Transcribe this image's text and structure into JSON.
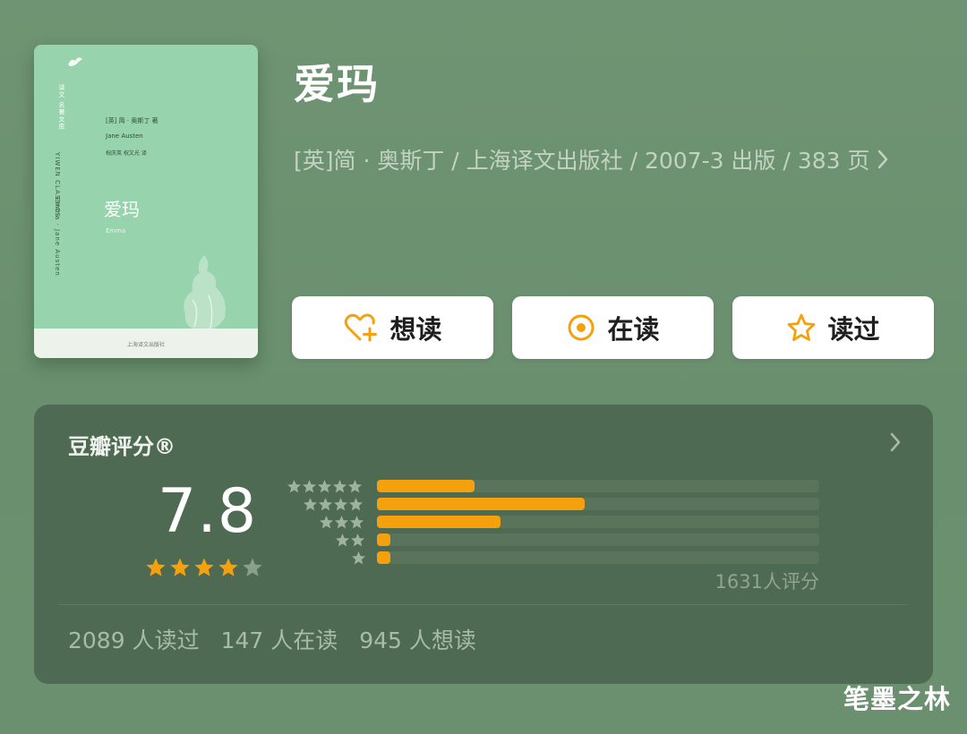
{
  "book": {
    "title": "爱玛",
    "info": "[英]简 · 奥斯丁 / 上海译文出版社 / 2007-3 出版 / 383 页"
  },
  "cover": {
    "series_cn": "译文 名著文库",
    "series_en": "YIWEN CLASSICS",
    "title_en_vertical": "Emma · Jane Austen",
    "author_cn": "[英] 简 · 奥斯丁 著",
    "author_en": "Jane Austen",
    "translator": "祝庆英 祝文光 译",
    "title": "爱玛",
    "subtitle": "Emma",
    "publisher": "上海译文出版社",
    "color": "#97d3ac"
  },
  "actions": [
    {
      "label": "想读",
      "icon": "heart-plus-icon"
    },
    {
      "label": "在读",
      "icon": "target-icon"
    },
    {
      "label": "读过",
      "icon": "star-outline-icon"
    }
  ],
  "rating": {
    "heading": "豆瓣评分®",
    "score": "7.8",
    "stars_filled": 4,
    "stars_total": 5,
    "distribution": [
      {
        "stars": 5,
        "fraction": 0.22
      },
      {
        "stars": 4,
        "fraction": 0.47
      },
      {
        "stars": 3,
        "fraction": 0.28
      },
      {
        "stars": 2,
        "fraction": 0.03
      },
      {
        "stars": 1,
        "fraction": 0.03
      }
    ],
    "count": "1631人评分",
    "read": "2089 人读过",
    "reading": "147 人在读",
    "want": "945 人想读"
  },
  "watermark": "笔墨之林",
  "colors": {
    "accent": "#f5a10d",
    "background": "#6f9473",
    "card": "#4f6a52"
  }
}
